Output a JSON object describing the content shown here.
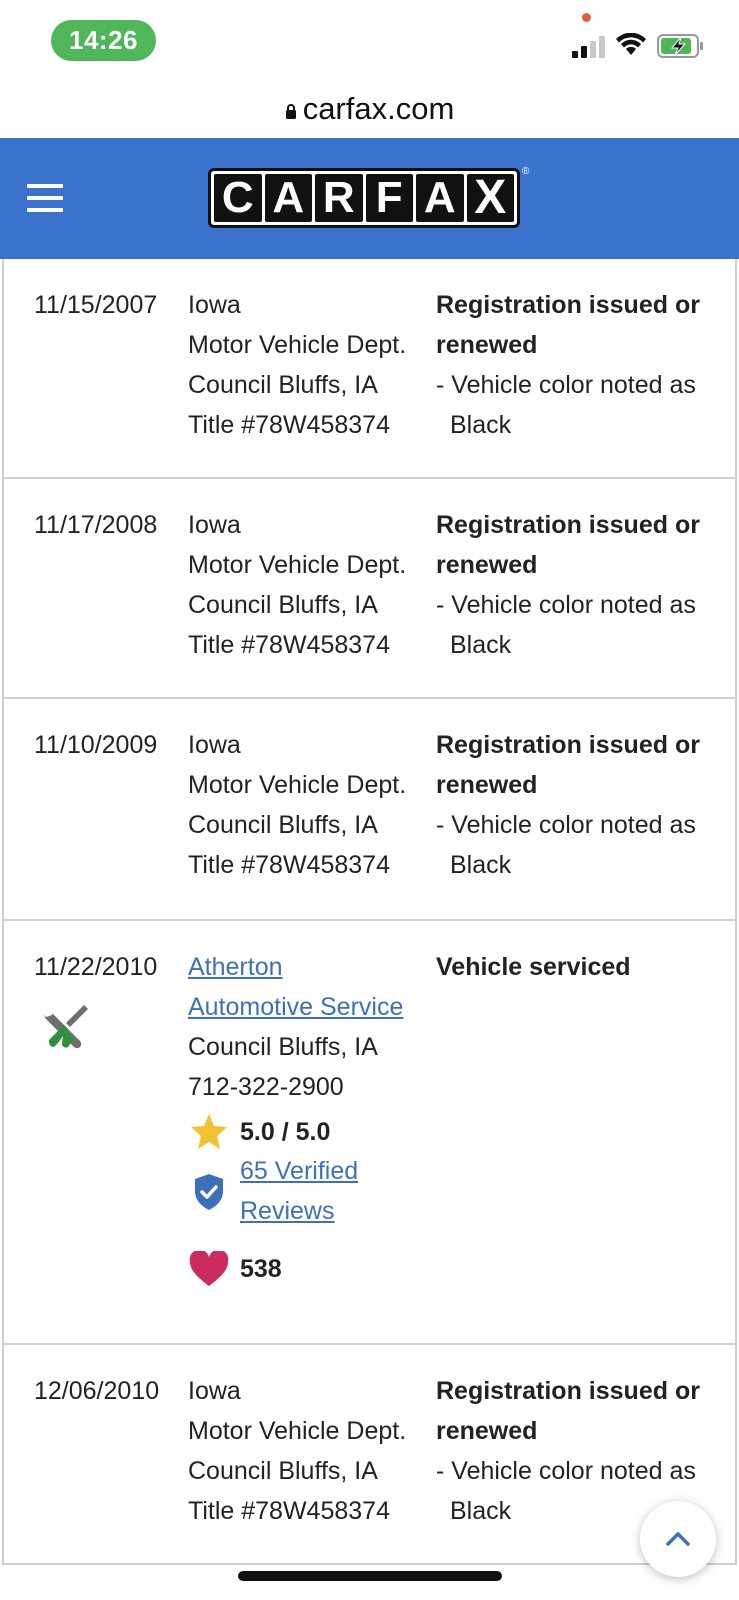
{
  "status_bar": {
    "time": "14:26",
    "time_pill_color": "#4fb65a",
    "icons": [
      "signal-icon",
      "wifi-icon",
      "battery-charging-icon"
    ]
  },
  "browser": {
    "url": "carfax.com"
  },
  "header": {
    "background_color": "#3b73cc",
    "menu_icon": "hamburger-menu-icon",
    "logo_letters": [
      "C",
      "A",
      "R",
      "F",
      "A",
      "X"
    ],
    "logo_registered_mark": "®"
  },
  "records": [
    {
      "date": "11/15/2007",
      "source": [
        "Iowa",
        "Motor Vehicle Dept.",
        "Council Bluffs, IA",
        "Title #78W458374"
      ],
      "headline": "Registration issued or renewed",
      "detail": "- Vehicle color noted as Black"
    },
    {
      "date": "11/17/2008",
      "source": [
        "Iowa",
        "Motor Vehicle Dept.",
        "Council Bluffs, IA",
        "Title #78W458374"
      ],
      "headline": "Registration issued or renewed",
      "detail": "- Vehicle color noted as Black"
    },
    {
      "date": "11/10/2009",
      "source": [
        "Iowa",
        "Motor Vehicle Dept.",
        "Council Bluffs, IA",
        "Title #78W458374"
      ],
      "headline": "Registration issued or renewed",
      "detail": "- Vehicle color noted as Black"
    },
    {
      "date": "11/22/2010",
      "source_link": [
        "Atherton",
        "Automotive Service"
      ],
      "source": [
        "Council Bluffs, IA",
        "712-322-2900"
      ],
      "headline": "Vehicle serviced",
      "service_icon": "wrench-screwdriver-icon",
      "rating": "5.0 / 5.0",
      "reviews_link": [
        "65 Verified",
        "Reviews"
      ],
      "favorites": "538",
      "colors": {
        "star": "#f2c230",
        "shield": "#3d70b8",
        "heart": "#cc2b5e",
        "link": "#3d70b8"
      }
    },
    {
      "date": "12/06/2010",
      "source": [
        "Iowa",
        "Motor Vehicle Dept.",
        "Council Bluffs, IA",
        "Title #78W458374"
      ],
      "headline": "Registration issued or renewed",
      "detail": "- Vehicle color noted as Black"
    }
  ],
  "scroll_top_button": {
    "icon": "chevron-up-icon"
  }
}
